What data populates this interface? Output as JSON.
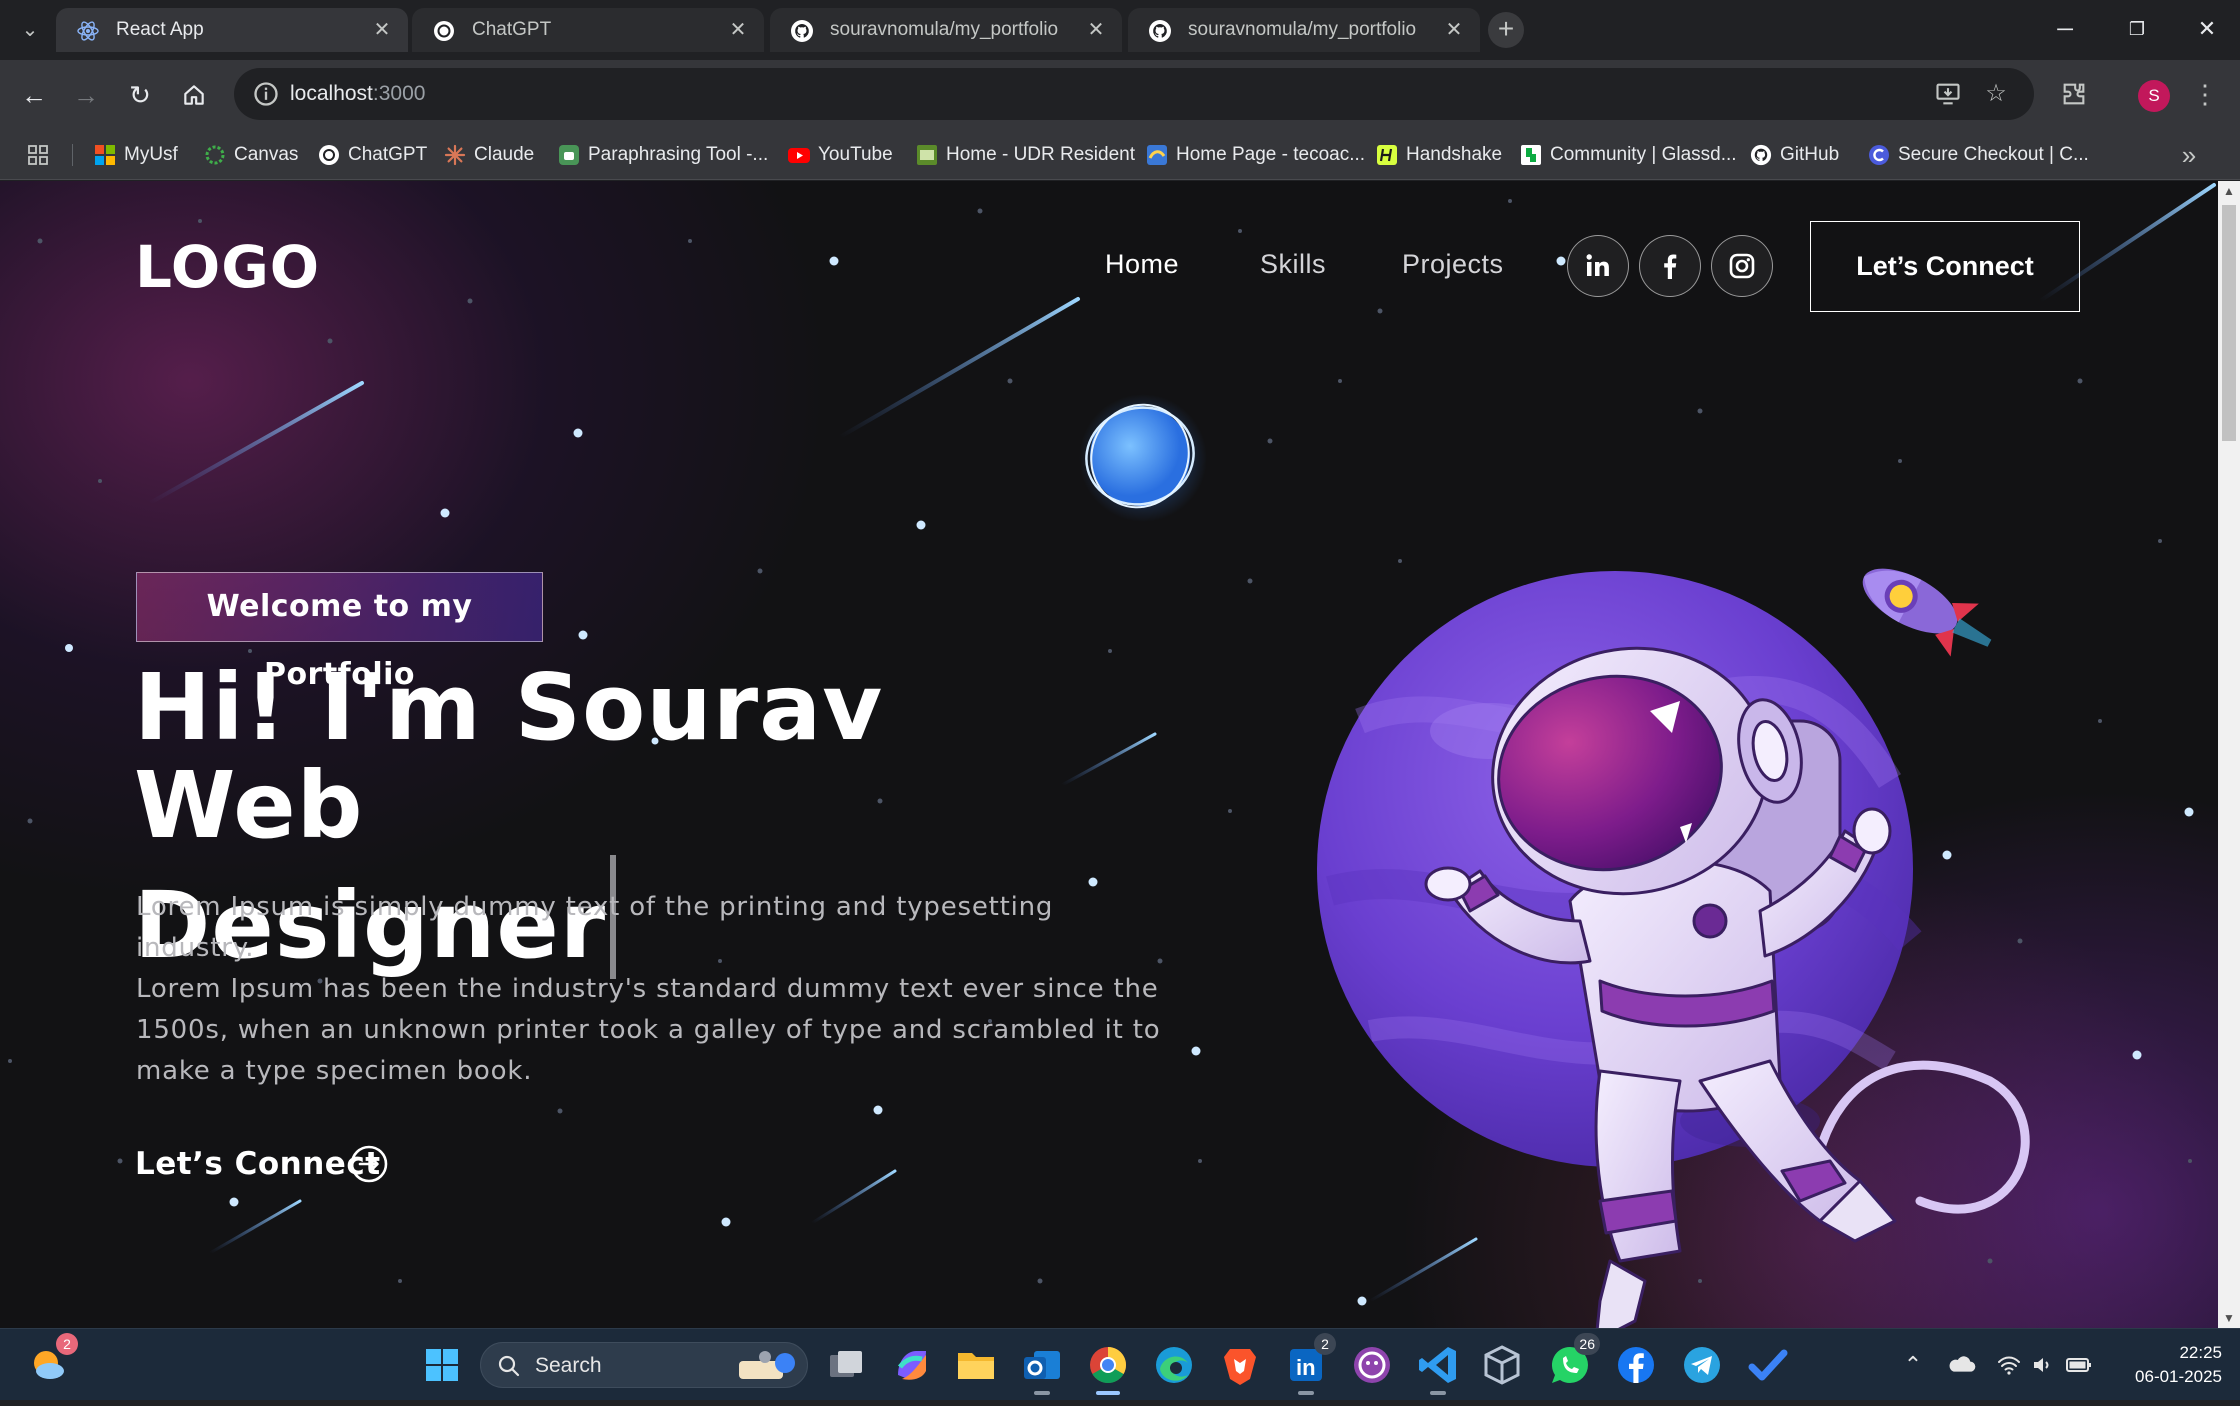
{
  "browser": {
    "tabs": [
      {
        "title": "React App",
        "favicon": "react-icon",
        "active": true
      },
      {
        "title": "ChatGPT",
        "favicon": "chatgpt-icon",
        "active": false
      },
      {
        "title": "souravnomula/my_portfolio",
        "favicon": "github-icon",
        "active": false
      },
      {
        "title": "souravnomula/my_portfolio",
        "favicon": "github-icon",
        "active": false
      }
    ],
    "url_host": "localhost",
    "url_port": ":3000",
    "bookmarks": [
      {
        "label": "MyUsf",
        "icon": "microsoft-icon"
      },
      {
        "label": "Canvas",
        "icon": "canvas-icon"
      },
      {
        "label": "ChatGPT",
        "icon": "chatgpt-icon"
      },
      {
        "label": "Claude",
        "icon": "claude-icon"
      },
      {
        "label": "Paraphrasing Tool -...",
        "icon": "quillbot-icon"
      },
      {
        "label": "YouTube",
        "icon": "youtube-icon"
      },
      {
        "label": "Home - UDR Resident",
        "icon": "udr-icon"
      },
      {
        "label": "Home Page - tecoac...",
        "icon": "teco-icon"
      },
      {
        "label": "Handshake",
        "icon": "handshake-icon"
      },
      {
        "label": "Community | Glassd...",
        "icon": "glassdoor-icon"
      },
      {
        "label": "GitHub",
        "icon": "github-icon"
      },
      {
        "label": "Secure Checkout | C...",
        "icon": "checkout-icon"
      }
    ]
  },
  "page": {
    "logo": "LOGO",
    "nav": {
      "home": "Home",
      "skills": "Skills",
      "projects": "Projects"
    },
    "social": [
      "linkedin-icon",
      "facebook-icon",
      "instagram-icon"
    ],
    "connect_button": "Let’s Connect",
    "welcome_tag": "Welcome to my Portfolio",
    "headline_line1": "Hi! I'm Sourav Web",
    "headline_line2": "Designer",
    "description_lines": [
      "Lorem Ipsum is simply dummy text of the printing and typesetting industry.",
      "Lorem Ipsum has been the industry's standard dummy text ever since the",
      "1500s, when an unknown printer took a galley of type and scrambled it to",
      "make a type specimen book."
    ],
    "cta_label": "Let’s Connect"
  },
  "taskbar": {
    "search_placeholder": "Search",
    "weather_badge": "2",
    "linkedin_badge": "2",
    "whatsapp_badge": "26",
    "time": "22:25",
    "date": "06-01-2025"
  },
  "colors": {
    "page_bg": "#121214",
    "accent_pink": "#aa367c",
    "accent_purple": "#4a2fbd",
    "planet": "#7b4fd6"
  }
}
